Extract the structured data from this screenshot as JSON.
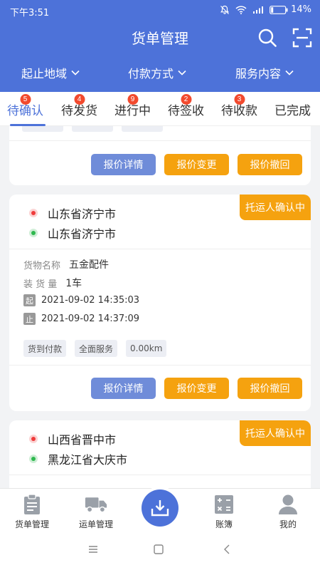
{
  "status_bar": {
    "time": "下午3:51",
    "battery": "14%"
  },
  "header": {
    "title": "货单管理",
    "filters": [
      {
        "label": "起止地域"
      },
      {
        "label": "付款方式"
      },
      {
        "label": "服务内容"
      }
    ]
  },
  "tabs": [
    {
      "label": "待确认",
      "badge": "5",
      "active": true
    },
    {
      "label": "待发货",
      "badge": "4"
    },
    {
      "label": "进行中",
      "badge": "9"
    },
    {
      "label": "待签收",
      "badge": "2"
    },
    {
      "label": "待收款",
      "badge": "3"
    },
    {
      "label": "已完成"
    }
  ],
  "buttons": {
    "detail": "报价详情",
    "change": "报价变更",
    "revoke": "报价撤回"
  },
  "labels": {
    "goods_name": "货物名称",
    "load_amount": "装 货 量",
    "start": "起",
    "end": "止"
  },
  "orders": [
    {
      "status": "托运人确认中",
      "from": "山东省济宁市",
      "to": "山东省济宁市",
      "goods": "五金配件",
      "amount": "1车",
      "start_time": "2021-09-02 14:35:03",
      "end_time": "2021-09-02 14:37:09",
      "tags": [
        "货到付款",
        "全面服务",
        "0.00km"
      ]
    },
    {
      "status": "托运人确认中",
      "from": "山西省晋中市",
      "to": "黑龙江省大庆市"
    }
  ],
  "bottom_nav": [
    {
      "label": "货单管理"
    },
    {
      "label": "运单管理"
    },
    {
      "label": "账簿"
    },
    {
      "label": "我的"
    }
  ]
}
